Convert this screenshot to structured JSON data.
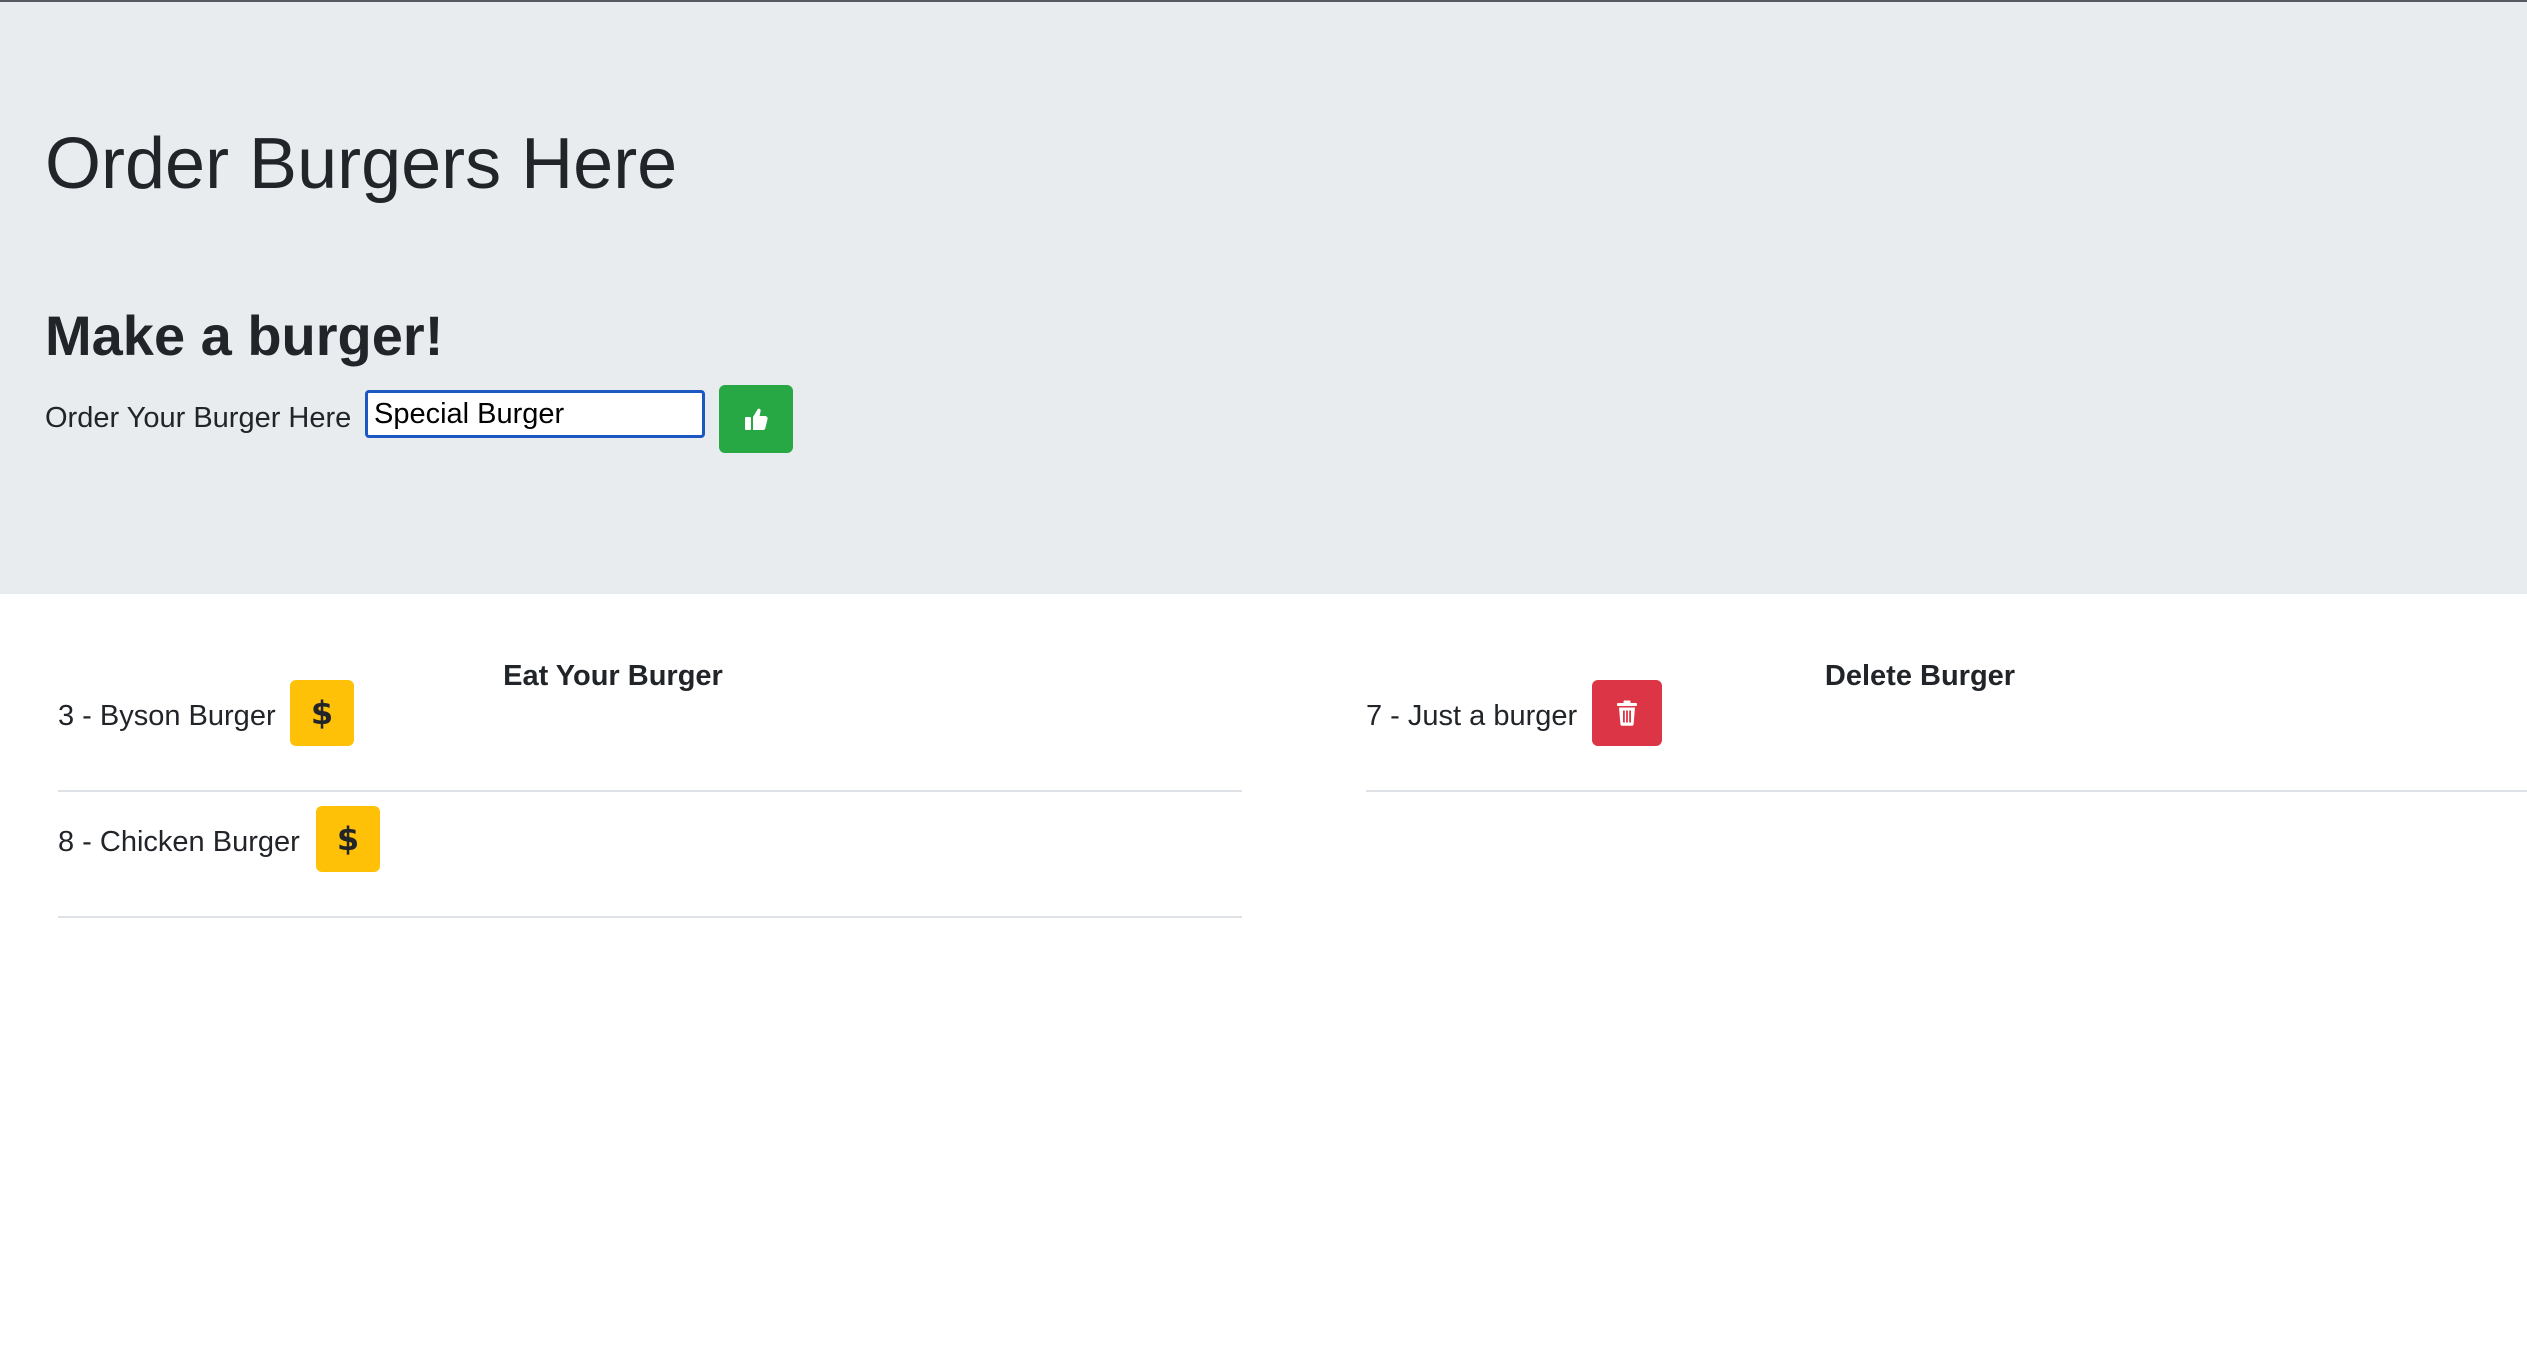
{
  "header": {
    "title": "Order Burgers Here",
    "subtitle": "Make a burger!",
    "order_label": "Order Your Burger Here",
    "order_input_value": "Special Burger",
    "submit_icon": "thumbs-up-icon"
  },
  "eat_column": {
    "heading": "Eat Your Burger",
    "items": [
      {
        "label": "3 - Byson Burger",
        "button_icon": "dollar-icon"
      },
      {
        "label": "8 - Chicken Burger",
        "button_icon": "dollar-icon"
      }
    ]
  },
  "delete_column": {
    "heading": "Delete Burger",
    "items": [
      {
        "label": "7 - Just a burger",
        "button_icon": "trash-icon"
      }
    ]
  },
  "colors": {
    "jumbotron_bg": "#e9ecef",
    "submit_button": "#28a745",
    "eat_button": "#ffc107",
    "delete_button": "#dc3545",
    "input_focus_border": "#1d57c2"
  }
}
